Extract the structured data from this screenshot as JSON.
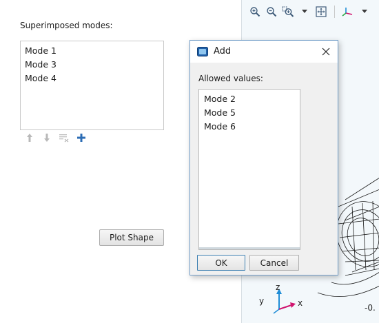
{
  "settings": {
    "superimposed_label": "Superimposed modes:",
    "modes": [
      "Mode 1",
      "Mode 3",
      "Mode 4"
    ],
    "toolbar_icons": [
      "move-up-icon",
      "move-down-icon",
      "clear-list-icon",
      "add-icon"
    ],
    "plot_button": "Plot Shape"
  },
  "graphics": {
    "toolbar_icons": [
      "zoom-in-icon",
      "zoom-out-icon",
      "zoom-box-icon",
      "dropdown-arrow-icon",
      "zoom-extents-icon",
      "axis-orientation-icon"
    ],
    "axes": {
      "z": "z",
      "y": "y",
      "x": "x"
    },
    "coord_text": "-0.",
    "background": "#f3f8fb"
  },
  "dialog": {
    "title": "Add",
    "allowed_label": "Allowed values:",
    "values": [
      "Mode 2",
      "Mode 5",
      "Mode 6"
    ],
    "ok": "OK",
    "cancel": "Cancel",
    "border_color": "#6f9bc7"
  },
  "colors": {
    "add_icon": "#2d6db5",
    "axis_x": "#d0146f",
    "axis_y": "#1e8cd6",
    "axis_z": "#1e8cd6"
  }
}
